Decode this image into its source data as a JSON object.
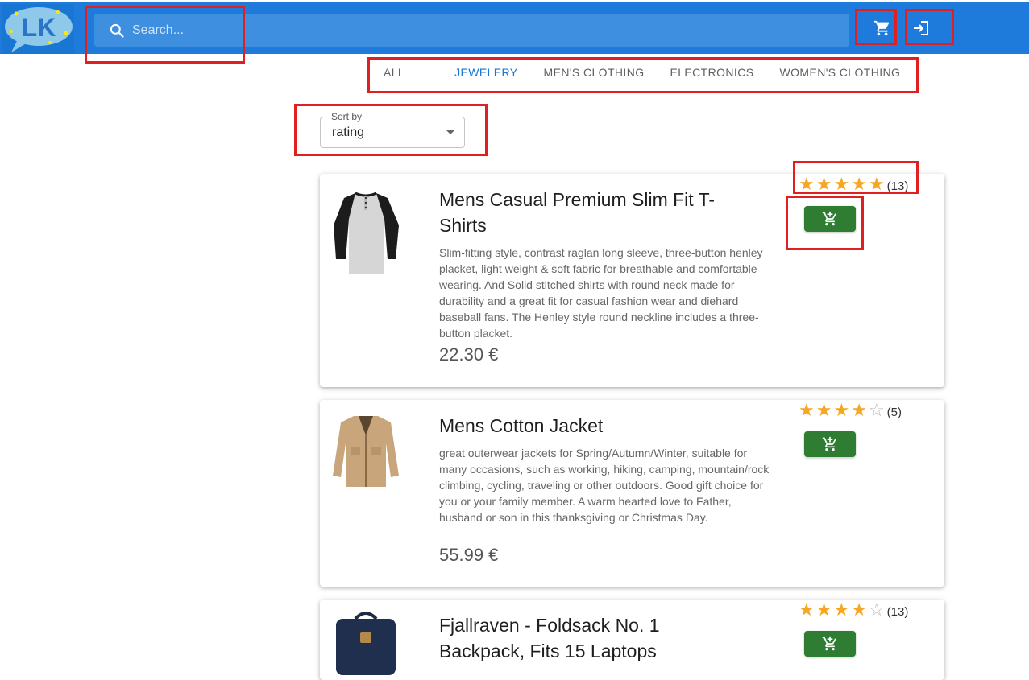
{
  "header": {
    "logo_text": "LK",
    "search": {
      "placeholder": "Search..."
    },
    "icons": [
      "shopping-cart-icon",
      "login-icon"
    ]
  },
  "tabs": [
    {
      "label": "ALL",
      "active": false
    },
    {
      "label": "JEWELERY",
      "active": true
    },
    {
      "label": "MEN'S CLOTHING",
      "active": false
    },
    {
      "label": "ELECTRONICS",
      "active": false
    },
    {
      "label": "WOMEN'S CLOTHING",
      "active": false
    }
  ],
  "sort": {
    "label": "Sort by",
    "value": "rating"
  },
  "products": [
    {
      "title": "Mens Casual Premium Slim Fit T-Shirts",
      "description": "Slim-fitting style, contrast raglan long sleeve, three-button henley placket, light weight & soft fabric for breathable and comfortable wearing. And Solid stitched shirts with round neck made for durability and a great fit for casual fashion wear and diehard baseball fans. The Henley style round neckline includes a three-button placket.",
      "price": "22.30 €",
      "rating_stars": 5,
      "rating_count": "(13)"
    },
    {
      "title": "Mens Cotton Jacket",
      "description": "great outerwear jackets for Spring/Autumn/Winter, suitable for many occasions, such as working, hiking, camping, mountain/rock climbing, cycling, traveling or other outdoors. Good gift choice for you or your family member. A warm hearted love to Father, husband or son in this thanksgiving or Christmas Day.",
      "price": "55.99 €",
      "rating_stars": 4,
      "rating_count": "(5)"
    },
    {
      "title": "Fjallraven - Foldsack No. 1 Backpack, Fits 15 Laptops",
      "description": "",
      "price": "",
      "rating_stars": 4,
      "rating_count": "(13)"
    }
  ],
  "colors": {
    "appbar": "#1e7bdb",
    "search_bg": "#3f8fe0",
    "active_tab": "#1976d2",
    "star": "#f5a623",
    "cart_button": "#2e7d32",
    "highlight": "#e02020"
  }
}
